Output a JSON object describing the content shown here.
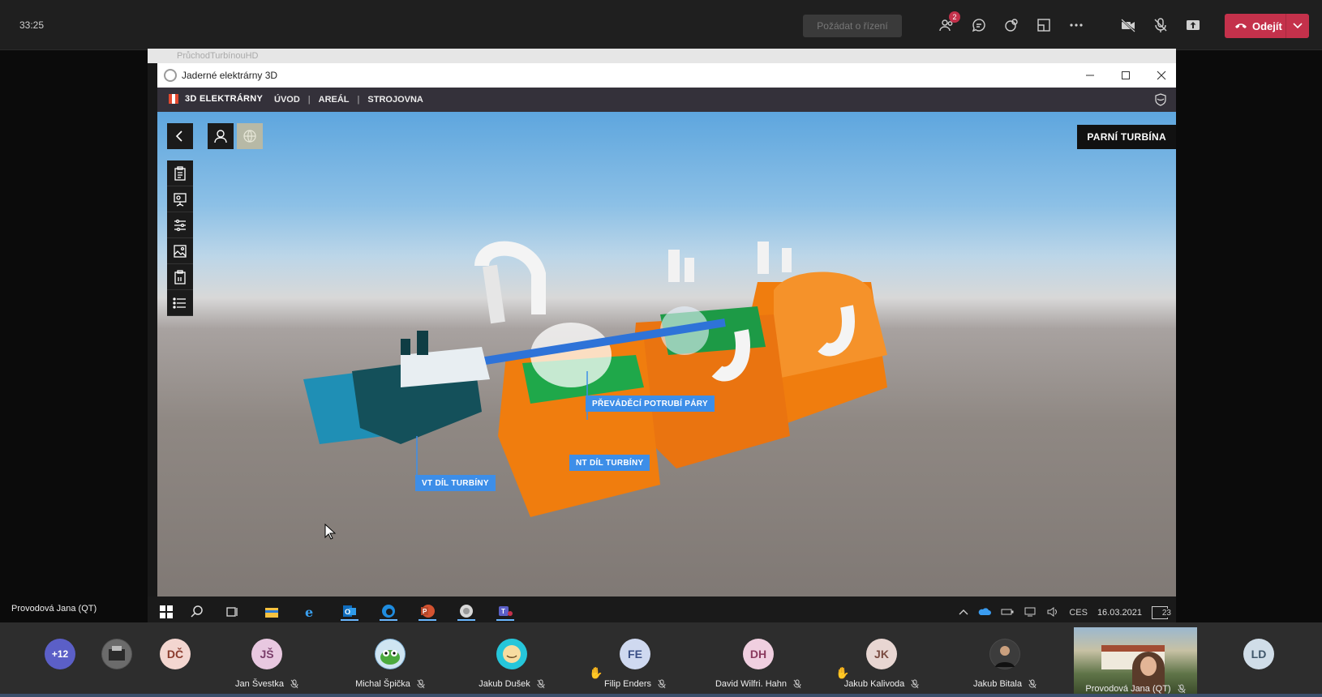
{
  "teams": {
    "timer": "33:25",
    "request_control_label": "Požádat o řízení",
    "participants_badge": "2",
    "leave_label": "Odejít",
    "icons": [
      "participants-icon",
      "chat-icon",
      "reactions-icon",
      "rooms-icon",
      "more-icon",
      "camera-off-icon",
      "mic-off-icon",
      "share-icon"
    ]
  },
  "browser": {
    "tab_title": "PrůchodTurbínouHD"
  },
  "app": {
    "window_title": "Jaderné elektrárny 3D",
    "brand": "3D ELEKTRÁRNY",
    "nav": [
      "ÚVOD",
      "AREÁL",
      "STROJOVNA"
    ],
    "section_title": "PARNÍ TURBÍNA",
    "labels": {
      "steam_pipe": "PŘEVÁDĚCÍ POTRUBÍ PÁRY",
      "lp_part": "NT DÍL TURBÍNY",
      "hp_part": "VT DÍL TURBÍNY"
    }
  },
  "taskbar": {
    "language": "CES",
    "date": "16.03.2021",
    "notifications": "23"
  },
  "presenter": "Provodová Jana (QT)",
  "participants": [
    {
      "initials": "+12",
      "name": "",
      "color": "#5b5fc7"
    },
    {
      "initials": "",
      "name": "",
      "color": "#555555"
    },
    {
      "initials": "DČ",
      "name": "",
      "color": "#f3d6d0"
    },
    {
      "initials": "JŠ",
      "name": "Jan Švestka",
      "color": "#e8c8e0"
    },
    {
      "initials": "",
      "name": "Michal Špička",
      "color": "#6aa0c8"
    },
    {
      "initials": "",
      "name": "Jakub Dušek",
      "color": "#26c6da"
    },
    {
      "initials": "FE",
      "name": "Filip Enders",
      "color": "#cfd9f0"
    },
    {
      "initials": "DH",
      "name": "David Wilfri. Hahn",
      "color": "#f0cfe0"
    },
    {
      "initials": "JK",
      "name": "Jakub Kalivoda",
      "color": "#e8d6d2"
    },
    {
      "initials": "",
      "name": "Jakub Bitala",
      "color": "#4a4a4a"
    },
    {
      "initials": "",
      "name": "Provodová Jana (QT)",
      "color": "#888888"
    },
    {
      "initials": "LD",
      "name": "",
      "color": "#d0dde8"
    }
  ]
}
